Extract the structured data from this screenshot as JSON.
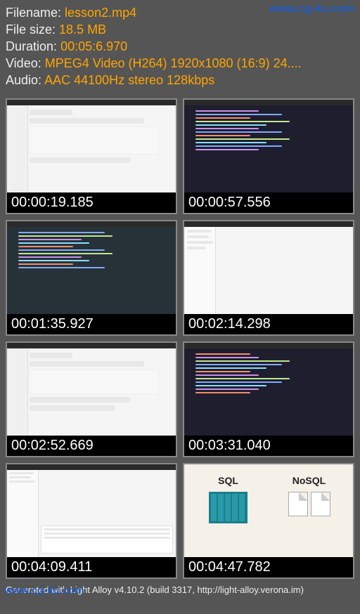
{
  "watermark": "www.cg-ku.com",
  "info": {
    "filename_label": "Filename:",
    "filename_value": "lesson2.mp4",
    "filesize_label": "File size:",
    "filesize_value": "18.5 MB",
    "duration_label": "Duration:",
    "duration_value": "00:05:6.970",
    "video_label": "Video:",
    "video_value": "MPEG4 Video (H264) 1920x1080 (16:9) 24....",
    "audio_label": "Audio:",
    "audio_value": "AAC 44100Hz stereo 128kbps"
  },
  "thumbs": [
    {
      "time": "00:00:19.185",
      "style": "light-ui"
    },
    {
      "time": "00:00:57.556",
      "style": "dark-code"
    },
    {
      "time": "00:01:35.927",
      "style": "ide-code"
    },
    {
      "time": "00:02:14.298",
      "style": "light-app"
    },
    {
      "time": "00:02:52.669",
      "style": "light-ui"
    },
    {
      "time": "00:03:31.040",
      "style": "dark-code"
    },
    {
      "time": "00:04:09.411",
      "style": "light-app"
    },
    {
      "time": "00:04:47.782",
      "style": "sql-nosql"
    }
  ],
  "sqlnosql": {
    "left": "SQL",
    "right": "NoSQL"
  },
  "footer": "Generated with Light Alloy v4.10.2 (build 3317, http://light-alloy.verona.im)"
}
